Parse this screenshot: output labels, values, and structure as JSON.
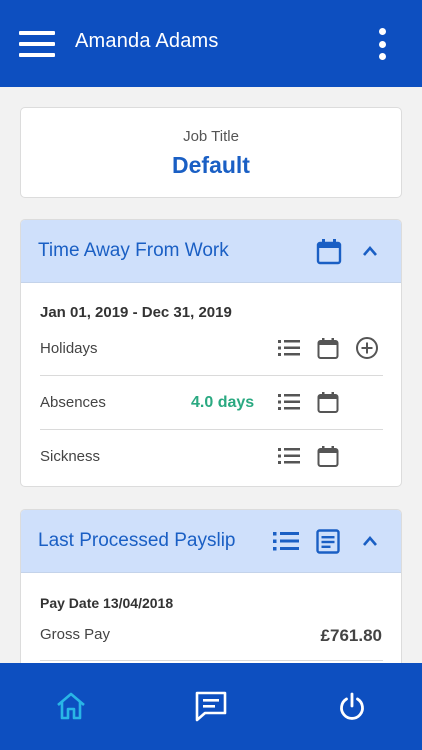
{
  "header": {
    "title": "Amanda Adams",
    "menu_icon": "hamburger-menu-icon",
    "more_icon": "more-vertical-icon"
  },
  "job": {
    "label": "Job Title",
    "value": "Default"
  },
  "time_away": {
    "title": "Time Away From Work",
    "period": "Jan 01, 2019 - Dec 31, 2019",
    "rows": [
      {
        "label": "Holidays",
        "value": ""
      },
      {
        "label": "Absences",
        "value": "4.0 days"
      },
      {
        "label": "Sickness",
        "value": ""
      }
    ]
  },
  "payslip": {
    "title": "Last Processed Payslip",
    "pay_date": "Pay Date 13/04/2018",
    "rows": [
      {
        "label": "Gross Pay",
        "value": "£761.80"
      }
    ]
  },
  "bottom_nav": {
    "items": [
      "home-icon",
      "messages-icon",
      "power-icon"
    ],
    "active": "home-icon"
  },
  "colors": {
    "primary": "#0d4fc0",
    "header_text": "#ffffff",
    "accent_blue": "#1a5fc4",
    "section_bg": "#cfe0fb",
    "positive_green": "#2aa981",
    "active_nav": "#29b6e6",
    "icon_gray": "#555555"
  }
}
